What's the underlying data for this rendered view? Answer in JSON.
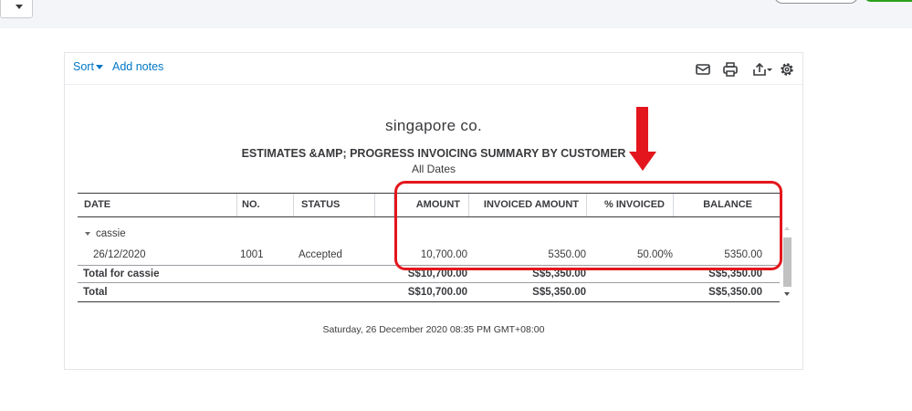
{
  "page": {
    "toolbar": {
      "sort_label": "Sort",
      "add_notes_label": "Add notes"
    },
    "icons": {
      "email": "email-icon",
      "print": "print-icon",
      "export": "export-icon",
      "settings": "gear-icon"
    },
    "report": {
      "company": "singapore co.",
      "title": "ESTIMATES &AMP; PROGRESS INVOICING SUMMARY BY CUSTOMER",
      "date_range": "All Dates",
      "columns": [
        "DATE",
        "NO.",
        "STATUS",
        "AMOUNT",
        "INVOICED AMOUNT",
        "% INVOICED",
        "BALANCE"
      ],
      "group": {
        "name": "cassie",
        "rows": [
          {
            "date": "26/12/2020",
            "no": "1001",
            "status": "Accepted",
            "amount": "10,700.00",
            "invoiced_amount": "5350.00",
            "pct_invoiced": "50.00%",
            "balance": "5350.00"
          }
        ],
        "total": {
          "label": "Total for cassie",
          "amount": "S$10,700.00",
          "invoiced_amount": "S$5,350.00",
          "balance": "S$5,350.00"
        }
      },
      "grand_total": {
        "label": "Total",
        "amount": "S$10,700.00",
        "invoiced_amount": "S$5,350.00",
        "balance": "S$5,350.00"
      },
      "footer": "Saturday, 26 December 2020  08:35 PM GMT+08:00"
    },
    "annotation_color": "#e4161d",
    "link_color": "#0077c5"
  }
}
